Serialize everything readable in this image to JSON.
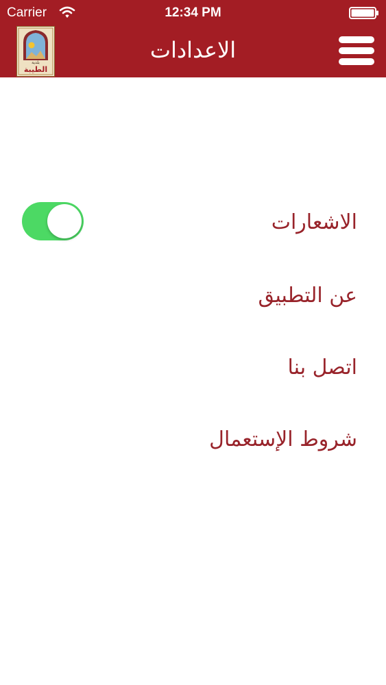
{
  "status_bar": {
    "carrier": "Carrier",
    "time": "12:34 PM"
  },
  "header": {
    "title": "الاعدادات",
    "background_color": "#a31d24",
    "logo_text": "الطيبة",
    "logo_subtext": "بلدية"
  },
  "settings": {
    "items": [
      {
        "label": "الاشعارات",
        "has_toggle": true,
        "toggle_on": true
      },
      {
        "label": "عن التطبيق"
      },
      {
        "label": "اتصل بنا"
      },
      {
        "label": "شروط الإستعمال"
      }
    ],
    "text_color": "#98232a",
    "toggle_on_color": "#4cd964"
  },
  "icons": {
    "menu": "hamburger-menu-icon",
    "wifi": "wifi-icon",
    "battery": "battery-icon"
  }
}
